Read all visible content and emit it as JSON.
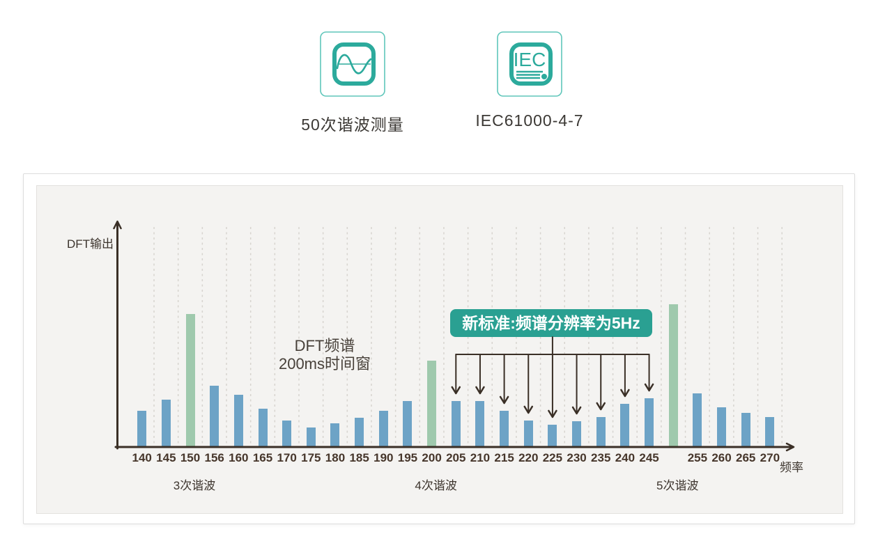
{
  "header": {
    "features": [
      {
        "label": "50次谐波测量",
        "icon": "sine-wave-icon"
      },
      {
        "label": "IEC61000-4-7",
        "icon": "iec-document-icon",
        "icon_text": "IEC"
      }
    ]
  },
  "colors": {
    "accent_teal": "#2caa9c",
    "accent_teal_light": "#5fc6ba",
    "badge_bg": "#2aa092",
    "badge_text": "#ffffff",
    "bar_blue": "#6da3c6",
    "bar_green": "#9fc9ad",
    "axis": "#3a2f26",
    "grid": "#d7d4cf",
    "chart_bg": "#f4f3f1",
    "panel_border": "#dcdcdc",
    "text_dark": "#3c342d"
  },
  "chart_data": {
    "type": "bar",
    "ylabel": "DFT输出",
    "xlabel": "频率",
    "annotation_line1": "DFT频谱",
    "annotation_line2": "200ms时间窗",
    "badge_label": "新标准:频谱分辨率为5Hz",
    "badge_targets": [
      205,
      210,
      215,
      220,
      225,
      230,
      235,
      240,
      245
    ],
    "grid": "vertical-dashed",
    "legend": "none",
    "y_axis_scale": "unlabeled (arbitrary DFT magnitude, values below are pixel-proportional)",
    "harmonics": [
      {
        "label": "3次谐波",
        "at": 150
      },
      {
        "label": "4次谐波",
        "at": 200
      },
      {
        "label": "5次谐波",
        "at": 250
      }
    ],
    "bars": [
      {
        "freq": 140,
        "tick": "140",
        "value": 52,
        "series": "dft"
      },
      {
        "freq": 145,
        "tick": "145",
        "value": 68,
        "series": "dft"
      },
      {
        "freq": 150,
        "tick": "150",
        "value": 191,
        "series": "harmonic"
      },
      {
        "freq": 156,
        "tick": "156",
        "value": 88,
        "series": "dft"
      },
      {
        "freq": 160,
        "tick": "160",
        "value": 75,
        "series": "dft"
      },
      {
        "freq": 165,
        "tick": "165",
        "value": 55,
        "series": "dft"
      },
      {
        "freq": 170,
        "tick": "170",
        "value": 38,
        "series": "dft"
      },
      {
        "freq": 175,
        "tick": "175",
        "value": 28,
        "series": "dft"
      },
      {
        "freq": 180,
        "tick": "180",
        "value": 34,
        "series": "dft"
      },
      {
        "freq": 185,
        "tick": "185",
        "value": 42,
        "series": "dft"
      },
      {
        "freq": 190,
        "tick": "190",
        "value": 52,
        "series": "dft"
      },
      {
        "freq": 195,
        "tick": "195",
        "value": 66,
        "series": "dft"
      },
      {
        "freq": 200,
        "tick": "200",
        "value": 124,
        "series": "harmonic"
      },
      {
        "freq": 205,
        "tick": "205",
        "value": 66,
        "series": "dft"
      },
      {
        "freq": 210,
        "tick": "210",
        "value": 66,
        "series": "dft"
      },
      {
        "freq": 215,
        "tick": "215",
        "value": 52,
        "series": "dft"
      },
      {
        "freq": 220,
        "tick": "220",
        "value": 38,
        "series": "dft"
      },
      {
        "freq": 225,
        "tick": "225",
        "value": 32,
        "series": "dft"
      },
      {
        "freq": 230,
        "tick": "230",
        "value": 37,
        "series": "dft"
      },
      {
        "freq": 235,
        "tick": "235",
        "value": 43,
        "series": "dft"
      },
      {
        "freq": 240,
        "tick": "240",
        "value": 62,
        "series": "dft"
      },
      {
        "freq": 245,
        "tick": "245",
        "value": 70,
        "series": "dft"
      },
      {
        "freq": 250,
        "tick": "",
        "value": 205,
        "series": "harmonic"
      },
      {
        "freq": 255,
        "tick": "255",
        "value": 77,
        "series": "dft"
      },
      {
        "freq": 260,
        "tick": "260",
        "value": 57,
        "series": "dft"
      },
      {
        "freq": 265,
        "tick": "265",
        "value": 49,
        "series": "dft"
      },
      {
        "freq": 270,
        "tick": "270",
        "value": 43,
        "series": "dft"
      }
    ]
  }
}
